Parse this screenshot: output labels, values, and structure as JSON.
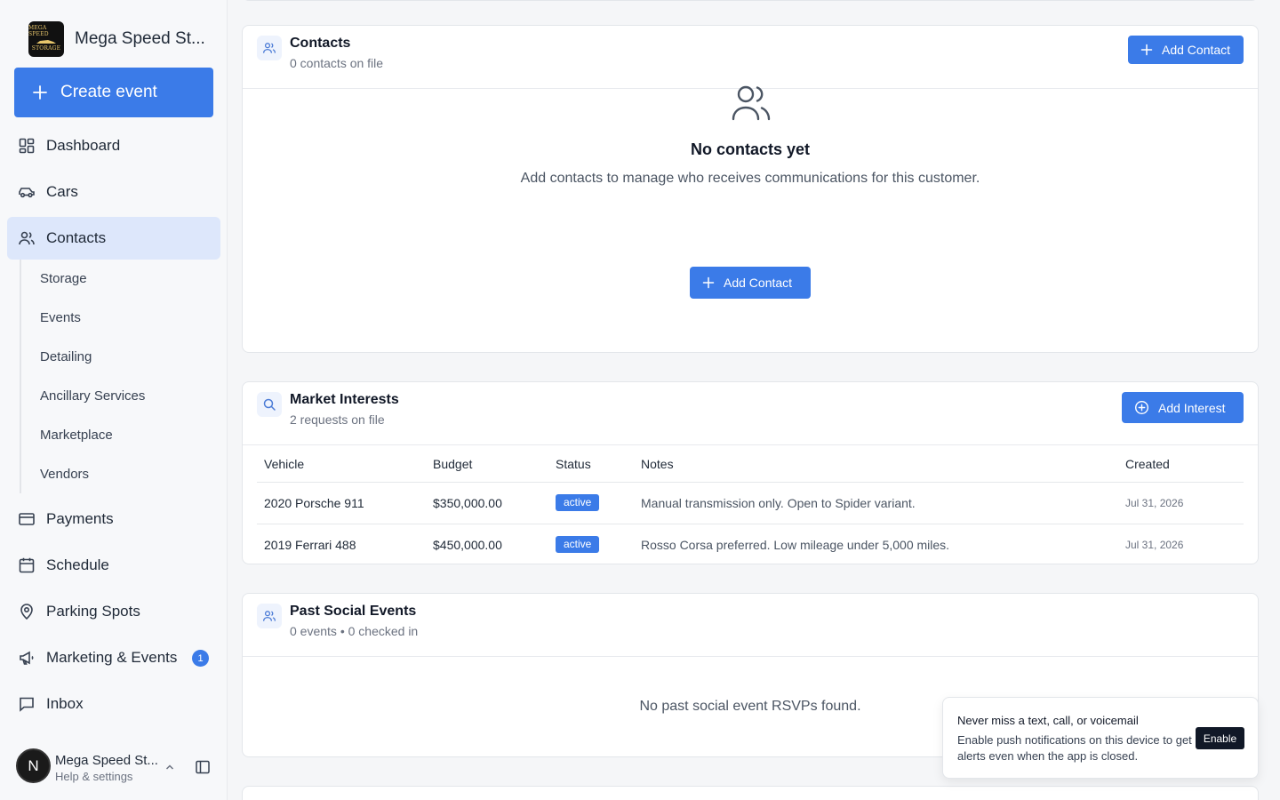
{
  "brand": {
    "name": "Mega Speed St...",
    "logo_top": "MEGA SPEED",
    "logo_mid": "MOTOR",
    "logo_bottom": "STORAGE"
  },
  "sidebar": {
    "create_label": "Create event",
    "items": [
      {
        "label": "Dashboard"
      },
      {
        "label": "Cars"
      },
      {
        "label": "Contacts"
      },
      {
        "label": "Payments"
      },
      {
        "label": "Schedule"
      },
      {
        "label": "Parking Spots"
      },
      {
        "label": "Marketing & Events",
        "badge": "1"
      },
      {
        "label": "Inbox"
      }
    ],
    "subitems": [
      "Storage",
      "Events",
      "Detailing",
      "Ancillary Services",
      "Marketplace",
      "Vendors"
    ],
    "user": {
      "initial": "N",
      "name": "Mega Speed St...",
      "sub": "Help & settings"
    }
  },
  "contacts": {
    "title": "Contacts",
    "subtitle": "0 contacts on file",
    "add_label": "Add Contact",
    "empty_title": "No contacts yet",
    "empty_desc": "Add contacts to manage who receives communications for this customer.",
    "empty_button": "Add Contact"
  },
  "market": {
    "title": "Market Interests",
    "subtitle": "2 requests on file",
    "add_label": "Add Interest",
    "columns": [
      "Vehicle",
      "Budget",
      "Status",
      "Notes",
      "Created"
    ],
    "rows": [
      {
        "vehicle": "2020 Porsche 911",
        "budget": "$350,000.00",
        "status": "active",
        "notes": "Manual transmission only. Open to Spider variant.",
        "created": "Jul 31, 2026"
      },
      {
        "vehicle": "2019 Ferrari 488",
        "budget": "$450,000.00",
        "status": "active",
        "notes": "Rosso Corsa preferred. Low mileage under 5,000 miles.",
        "created": "Jul 31, 2026"
      }
    ]
  },
  "social": {
    "title": "Past Social Events",
    "subtitle": "0 events • 0 checked in",
    "empty": "No past social event RSVPs found."
  },
  "toast": {
    "title": "Never miss a text, call, or voicemail",
    "body": "Enable push notifications on this device to get alerts even when the app is closed.",
    "button": "Enable"
  },
  "colors": {
    "accent": "#3b7be8",
    "active_nav": "#dde7fb"
  }
}
